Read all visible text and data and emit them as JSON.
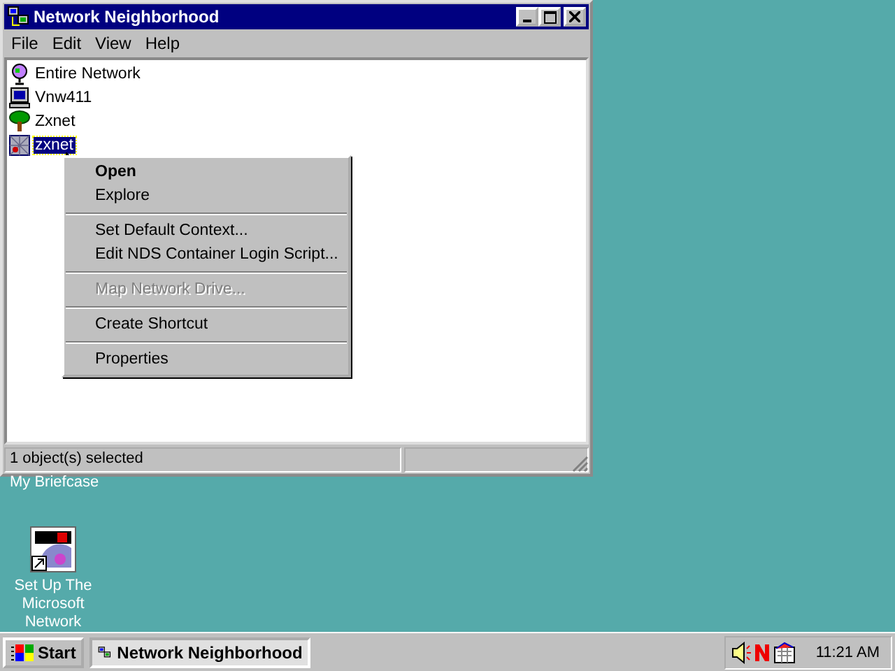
{
  "window": {
    "title": "Network Neighborhood",
    "menu": [
      {
        "label": "File"
      },
      {
        "label": "Edit"
      },
      {
        "label": "View"
      },
      {
        "label": "Help"
      }
    ],
    "items": [
      {
        "kind": "globe",
        "label": "Entire Network",
        "selected": false
      },
      {
        "kind": "computer",
        "label": "Vnw411",
        "selected": false
      },
      {
        "kind": "tree",
        "label": "Zxnet",
        "selected": false
      },
      {
        "kind": "container",
        "label": "zxnet",
        "selected": true
      }
    ],
    "status_bar": "1 object(s) selected"
  },
  "context_menu": [
    {
      "kind": "item",
      "label": "Open",
      "default": true,
      "disabled": false
    },
    {
      "kind": "item",
      "label": "Explore",
      "default": false,
      "disabled": false
    },
    {
      "kind": "separator"
    },
    {
      "kind": "item",
      "label": "Set Default Context...",
      "default": false,
      "disabled": false
    },
    {
      "kind": "item",
      "label": "Edit NDS Container Login Script...",
      "default": false,
      "disabled": false
    },
    {
      "kind": "separator"
    },
    {
      "kind": "item",
      "label": "Map Network Drive...",
      "default": false,
      "disabled": true
    },
    {
      "kind": "separator"
    },
    {
      "kind": "item",
      "label": "Create Shortcut",
      "default": false,
      "disabled": false
    },
    {
      "kind": "separator"
    },
    {
      "kind": "item",
      "label": "Properties",
      "default": false,
      "disabled": false
    }
  ],
  "desktop": {
    "briefcase_label": "My Briefcase",
    "msn_label": "Set Up The Microsoft Network"
  },
  "taskbar": {
    "start": "Start",
    "tasks": [
      {
        "label": "Network Neighborhood",
        "selected": true
      }
    ],
    "clock": "11:21 AM"
  }
}
